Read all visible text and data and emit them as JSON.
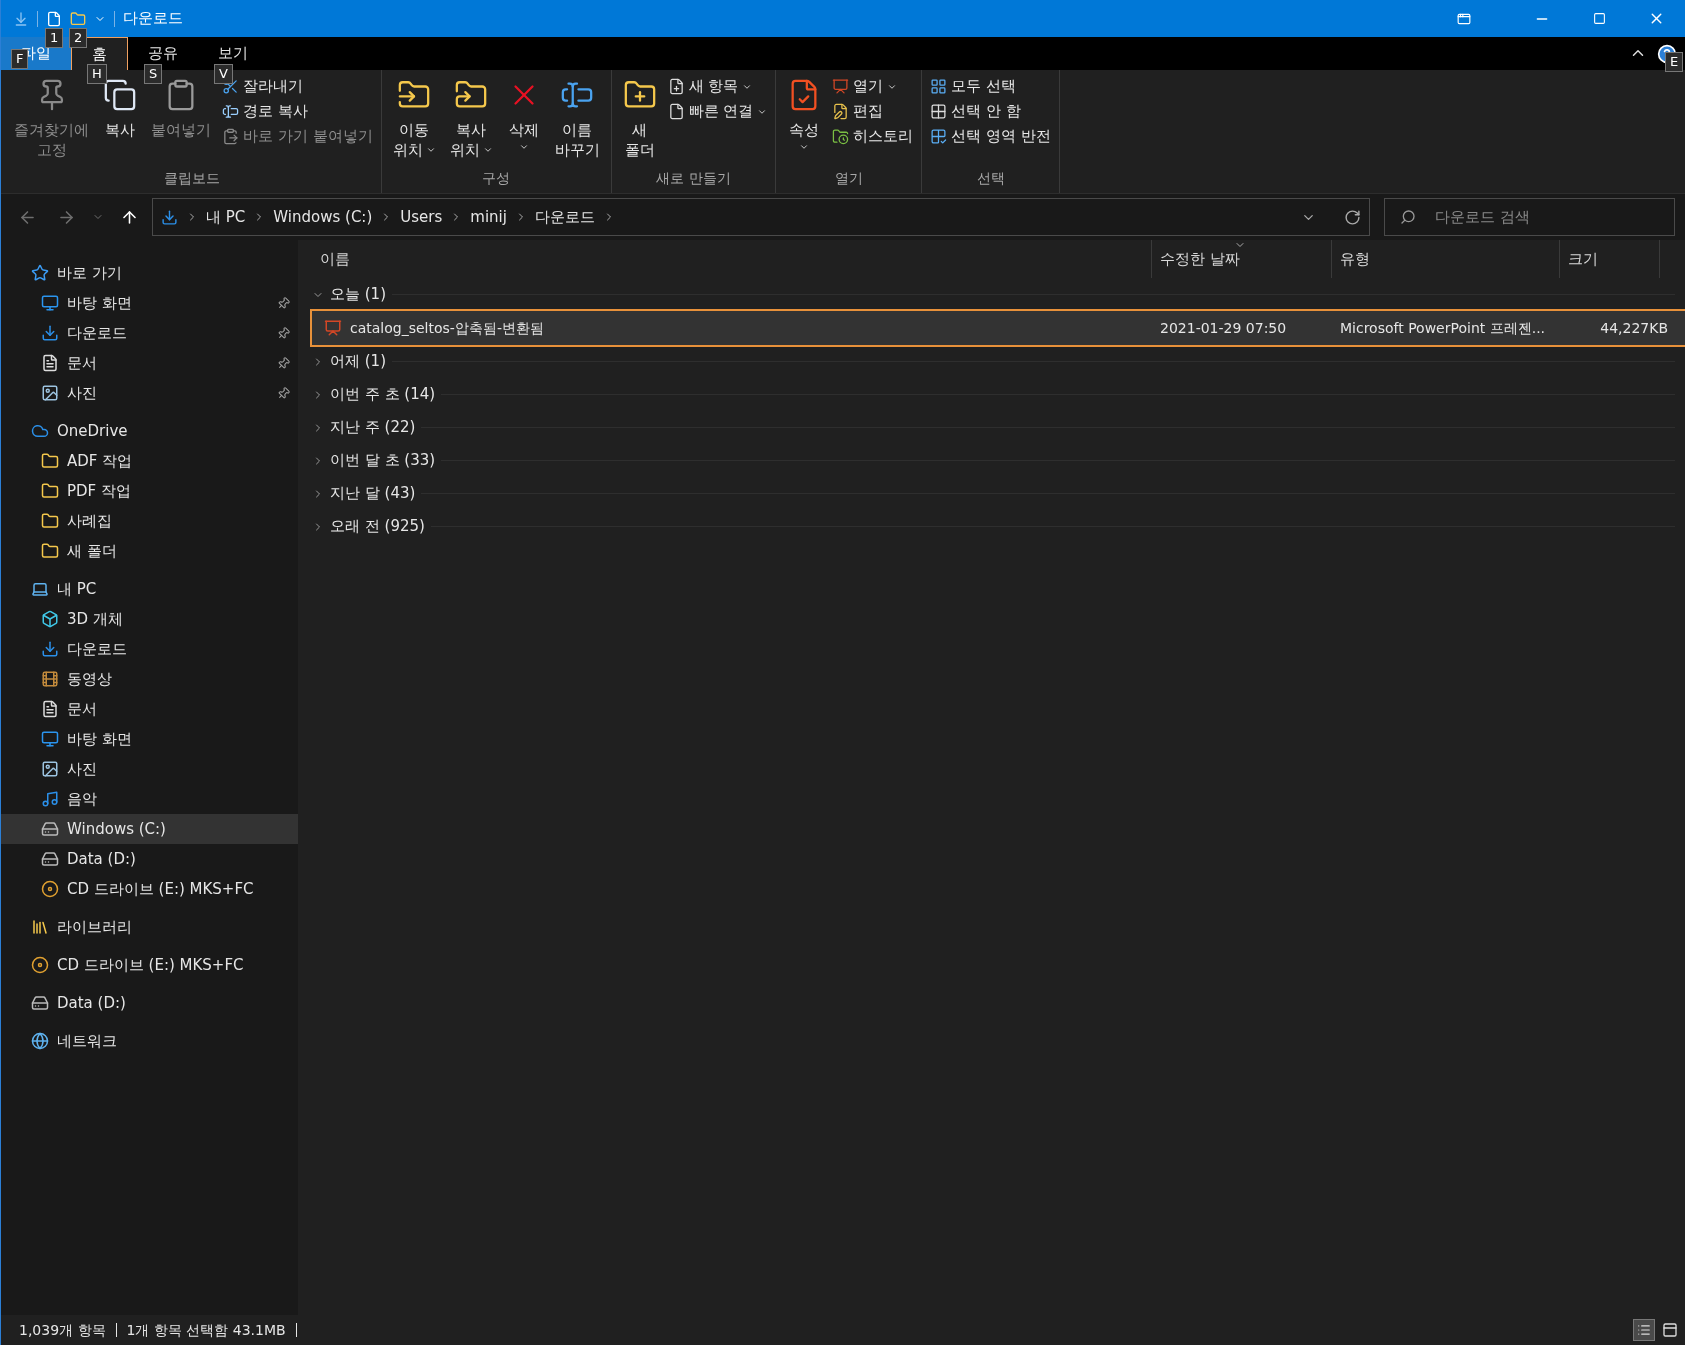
{
  "title_bar": {
    "title": "다운로드",
    "keytips": [
      "1",
      "2"
    ]
  },
  "ribbon_tabs": [
    {
      "label": "파일",
      "kind": "file",
      "keytip": "F",
      "selected": false
    },
    {
      "label": "홈",
      "kind": "tab",
      "keytip": "H",
      "selected": true
    },
    {
      "label": "공유",
      "kind": "tab",
      "keytip": "S",
      "selected": false
    },
    {
      "label": "보기",
      "kind": "tab",
      "keytip": "V",
      "selected": false
    }
  ],
  "help_keytip": "E",
  "ribbon_groups": [
    {
      "label": "클립보드",
      "items": [
        {
          "kind": "large",
          "lines": [
            "즐겨찾기에",
            "고정"
          ],
          "disabled": true,
          "dropdown": false
        },
        {
          "kind": "large",
          "lines": [
            "복사"
          ],
          "disabled": false,
          "dropdown": false
        },
        {
          "kind": "large",
          "lines": [
            "붙여넣기"
          ],
          "disabled": true,
          "dropdown": false
        },
        {
          "kind": "small",
          "lines": [
            "잘라내기"
          ],
          "disabled": false,
          "dropdown": false
        },
        {
          "kind": "small",
          "lines": [
            "경로 복사"
          ],
          "disabled": false,
          "dropdown": false
        },
        {
          "kind": "small",
          "lines": [
            "바로 가기 붙여넣기"
          ],
          "disabled": true,
          "dropdown": false
        }
      ]
    },
    {
      "label": "구성",
      "items": [
        {
          "kind": "large",
          "lines": [
            "이동",
            "위치"
          ],
          "disabled": false,
          "dropdown": true
        },
        {
          "kind": "large",
          "lines": [
            "복사",
            "위치"
          ],
          "disabled": false,
          "dropdown": true
        },
        {
          "kind": "large",
          "lines": [
            "삭제"
          ],
          "disabled": false,
          "dropdown": true
        },
        {
          "kind": "large",
          "lines": [
            "이름",
            "바꾸기"
          ],
          "disabled": false,
          "dropdown": false
        }
      ]
    },
    {
      "label": "새로 만들기",
      "items": [
        {
          "kind": "large",
          "lines": [
            "새",
            "폴더"
          ],
          "disabled": false,
          "dropdown": false
        },
        {
          "kind": "small",
          "lines": [
            "새 항목"
          ],
          "disabled": false,
          "dropdown": true
        },
        {
          "kind": "small",
          "lines": [
            "빠른 연결"
          ],
          "disabled": false,
          "dropdown": true
        }
      ]
    },
    {
      "label": "열기",
      "items": [
        {
          "kind": "large",
          "lines": [
            "속성"
          ],
          "disabled": false,
          "dropdown": true
        },
        {
          "kind": "small",
          "lines": [
            "열기"
          ],
          "disabled": false,
          "dropdown": true
        },
        {
          "kind": "small",
          "lines": [
            "편집"
          ],
          "disabled": false,
          "dropdown": false
        },
        {
          "kind": "small",
          "lines": [
            "히스토리"
          ],
          "disabled": false,
          "dropdown": false
        }
      ]
    },
    {
      "label": "선택",
      "items": [
        {
          "kind": "small",
          "lines": [
            "모두 선택"
          ],
          "disabled": false,
          "dropdown": false
        },
        {
          "kind": "small",
          "lines": [
            "선택 안 함"
          ],
          "disabled": false,
          "dropdown": false
        },
        {
          "kind": "small",
          "lines": [
            "선택 영역 반전"
          ],
          "disabled": false,
          "dropdown": false
        }
      ]
    }
  ],
  "navigation": [
    {
      "kind": "back",
      "disabled": true
    },
    {
      "kind": "forward",
      "disabled": true
    },
    {
      "kind": "recent",
      "disabled": true
    },
    {
      "kind": "up",
      "disabled": false
    }
  ],
  "breadcrumb": [
    "내 PC",
    "Windows (C:)",
    "Users",
    "minij",
    "다운로드"
  ],
  "search": {
    "placeholder": "다운로드 검색"
  },
  "sidebar": [
    {
      "label": "바로 가기",
      "kind": "star",
      "selected": false,
      "children": [
        {
          "label": "바탕 화면",
          "kind": "desktop",
          "selected": false,
          "pinned": true
        },
        {
          "label": "다운로드",
          "kind": "download",
          "selected": false,
          "pinned": true
        },
        {
          "label": "문서",
          "kind": "document",
          "selected": false,
          "pinned": true
        },
        {
          "label": "사진",
          "kind": "picture",
          "selected": false,
          "pinned": true
        }
      ]
    },
    {
      "label": "OneDrive",
      "kind": "cloud",
      "selected": false,
      "children": [
        {
          "label": "ADF 작업",
          "kind": "folder",
          "selected": false
        },
        {
          "label": "PDF 작업",
          "kind": "folder",
          "selected": false
        },
        {
          "label": "사례집",
          "kind": "folder",
          "selected": false
        },
        {
          "label": "새 폴더",
          "kind": "folder",
          "selected": false
        }
      ]
    },
    {
      "label": "내 PC",
      "kind": "pc",
      "selected": false,
      "children": [
        {
          "label": "3D 개체",
          "kind": "cube",
          "selected": false
        },
        {
          "label": "다운로드",
          "kind": "download",
          "selected": false
        },
        {
          "label": "동영상",
          "kind": "video",
          "selected": false
        },
        {
          "label": "문서",
          "kind": "document",
          "selected": false
        },
        {
          "label": "바탕 화면",
          "kind": "desktop",
          "selected": false
        },
        {
          "label": "사진",
          "kind": "picture",
          "selected": false
        },
        {
          "label": "음악",
          "kind": "music",
          "selected": false
        },
        {
          "label": "Windows (C:)",
          "kind": "drive",
          "selected": true
        },
        {
          "label": "Data (D:)",
          "kind": "drive",
          "selected": false
        },
        {
          "label": "CD 드라이브 (E:) MKS+FC",
          "kind": "cd",
          "selected": false
        }
      ]
    },
    {
      "label": "라이브러리",
      "kind": "library",
      "selected": false
    },
    {
      "label": "CD 드라이브 (E:) MKS+FC",
      "kind": "cd",
      "selected": false
    },
    {
      "label": "Data (D:)",
      "kind": "drive",
      "selected": false
    },
    {
      "label": "네트워크",
      "kind": "network",
      "selected": false
    }
  ],
  "columns": [
    {
      "label": "이름",
      "sorted": false
    },
    {
      "label": "수정한 날짜",
      "sorted": true
    },
    {
      "label": "유형",
      "sorted": false
    },
    {
      "label": "크기",
      "sorted": false
    }
  ],
  "file_groups": [
    {
      "label": "오늘 (1)",
      "expanded": true,
      "files": [
        {
          "name": "catalog_seltos-압축됨-변환됨",
          "modified": "2021-01-29 07:50",
          "type": "Microsoft PowerPoint 프레젠...",
          "size": "44,227KB",
          "selected": true
        }
      ]
    },
    {
      "label": "어제 (1)",
      "expanded": false
    },
    {
      "label": "이번 주 초 (14)",
      "expanded": false
    },
    {
      "label": "지난 주 (22)",
      "expanded": false
    },
    {
      "label": "이번 달 초 (33)",
      "expanded": false
    },
    {
      "label": "지난 달 (43)",
      "expanded": false
    },
    {
      "label": "오래 전 (925)",
      "expanded": false
    }
  ],
  "status_bar": [
    "1,039개 항목",
    "1개 항목 선택함 43.1MB"
  ],
  "views": [
    {
      "kind": "details",
      "selected": true
    },
    {
      "kind": "tiles",
      "selected": false
    }
  ]
}
